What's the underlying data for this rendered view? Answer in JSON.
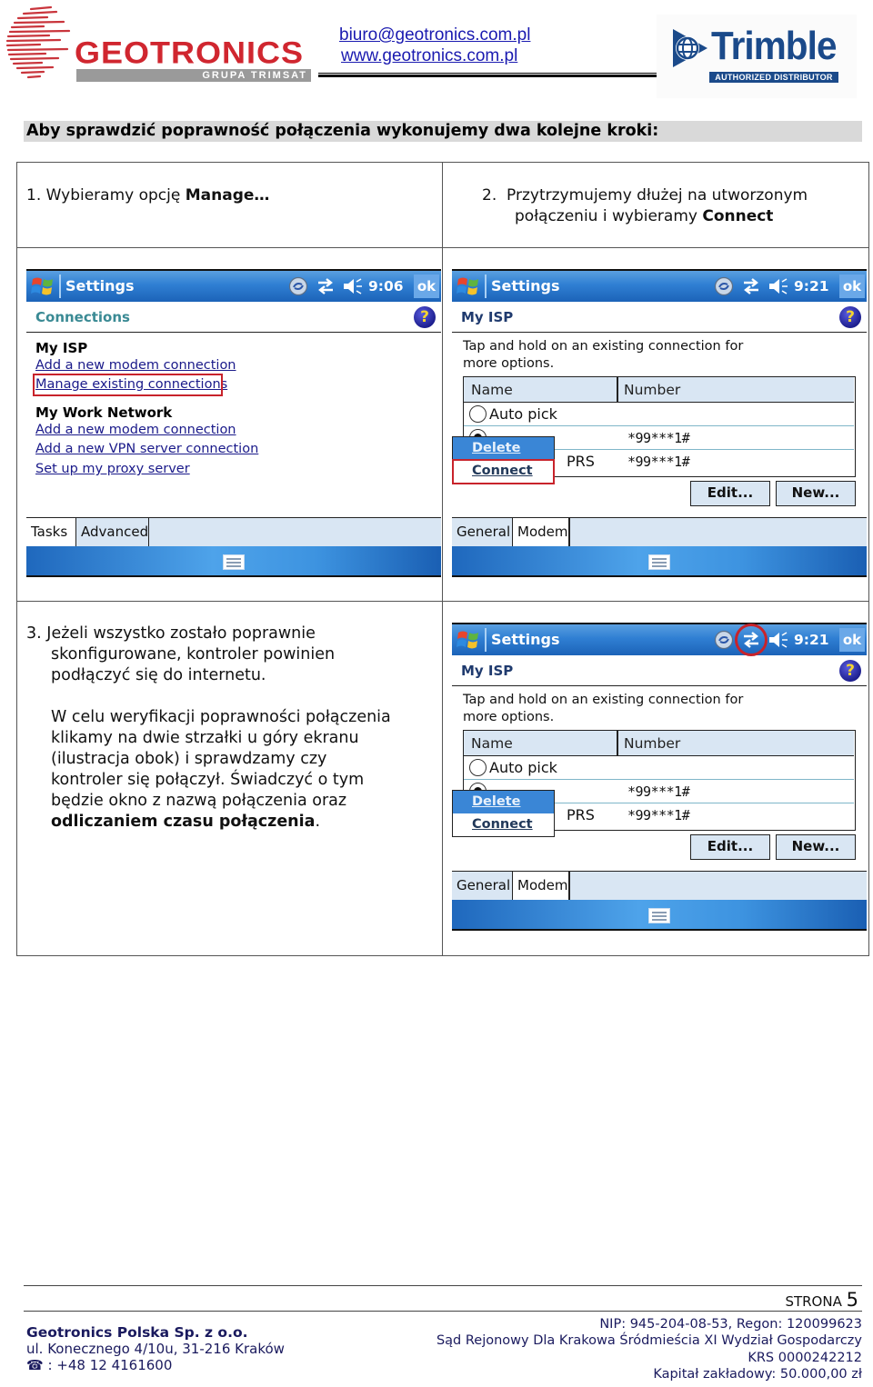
{
  "header": {
    "logo_left": {
      "name": "GEOTRONICS",
      "tagline": "GRUPA TRIMSAT",
      "brand_color": "#d0262f"
    },
    "email": "biuro@geotronics.com.pl",
    "website": "www.geotronics.com.pl",
    "logo_right": {
      "name": "Trimble",
      "badge": "AUTHORIZED DISTRIBUTOR",
      "brand_color": "#1b4a8a"
    }
  },
  "intro_heading": "Aby sprawdzić poprawność połączenia wykonujemy dwa kolejne kroki:",
  "steps": [
    {
      "number": "1.",
      "text": "Wybieramy opcję ",
      "bold": "Manage…"
    },
    {
      "number": "2.",
      "line1": "Przytrzymujemy dłużej na utworzonym",
      "line2_prefix": "połączeniu i wybieramy ",
      "bold": "Connect"
    },
    {
      "number": "3.",
      "para1": [
        "Jeżeli wszystko zostało poprawnie",
        "skonfigurowane, kontroler powinien",
        "podłączyć się do internetu."
      ],
      "para2": [
        "W celu weryfikacji poprawności połączenia",
        "klikamy na dwie strzałki u góry ekranu",
        "(ilustracja obok) i sprawdzamy czy",
        "kontroler się połączył. Świadczyć o tym",
        "będzie okno z nazwą połączenia oraz"
      ],
      "para2_bold": "odliczaniem czasu połączenia",
      "para2_end": "."
    }
  ],
  "screens": [
    {
      "title": "Settings",
      "time": "9:06",
      "ok": "ok",
      "subheader": "Connections",
      "help": "?",
      "sections": [
        {
          "title": "My ISP",
          "links": [
            "Add a new modem connection",
            "Manage existing connections"
          ]
        },
        {
          "title": "My Work Network",
          "links": [
            "Add a new modem connection",
            "Add a new VPN server connection",
            "Set up my proxy server"
          ]
        }
      ],
      "highlighted_link": "Manage existing connections",
      "tabs": [
        {
          "label": "Tasks",
          "active": true
        },
        {
          "label": "Advanced",
          "active": false
        }
      ]
    },
    {
      "title": "Settings",
      "time": "9:21",
      "ok": "ok",
      "subheader": "My ISP",
      "help": "?",
      "instructions": [
        "Tap and hold on an existing connection for",
        "more options."
      ],
      "columns": [
        "Name",
        "Number"
      ],
      "rows": [
        {
          "name": "Auto pick",
          "number": "",
          "selected": false
        },
        {
          "name": "",
          "number": "*99***1#",
          "selected": true
        },
        {
          "name": "PRS",
          "number": "*99***1#",
          "selected": false
        }
      ],
      "context_menu": [
        "Delete",
        "Connect"
      ],
      "context_menu_selected": "Delete",
      "highlighted_menu_item": "Connect",
      "buttons": [
        "Edit...",
        "New..."
      ],
      "tabs": [
        {
          "label": "General",
          "active": false
        },
        {
          "label": "Modem",
          "active": true
        }
      ]
    },
    {
      "title": "Settings",
      "time": "9:21",
      "ok": "ok",
      "subheader": "My ISP",
      "help": "?",
      "instructions": [
        "Tap and hold on an existing connection for",
        "more options."
      ],
      "columns": [
        "Name",
        "Number"
      ],
      "rows": [
        {
          "name": "Auto pick",
          "number": "",
          "selected": false
        },
        {
          "name": "",
          "number": "*99***1#",
          "selected": true
        },
        {
          "name": "PRS",
          "number": "*99***1#",
          "selected": false
        }
      ],
      "context_menu": [
        "Delete",
        "Connect"
      ],
      "context_menu_selected": "Delete",
      "highlighted_status_icon": "connectivity-arrows",
      "buttons": [
        "Edit...",
        "New..."
      ],
      "tabs": [
        {
          "label": "General",
          "active": false
        },
        {
          "label": "Modem",
          "active": true
        }
      ]
    }
  ],
  "footer": {
    "page_label": "STRONA",
    "page_number": "5",
    "company": "Geotronics Polska Sp. z o.o.",
    "address": "ul. Konecznego 4/10u, 31-216 Kraków",
    "phone_icon": "☎",
    "phone": ": +48 12 4161600",
    "nip_regon": "NIP: 945-204-08-53, Regon: 120099623",
    "court": "Sąd Rejonowy Dla Krakowa Śródmieścia XI Wydział Gospodarczy",
    "krs": "KRS 0000242212",
    "capital": "Kapitał zakładowy: 50.000,00 zł"
  }
}
